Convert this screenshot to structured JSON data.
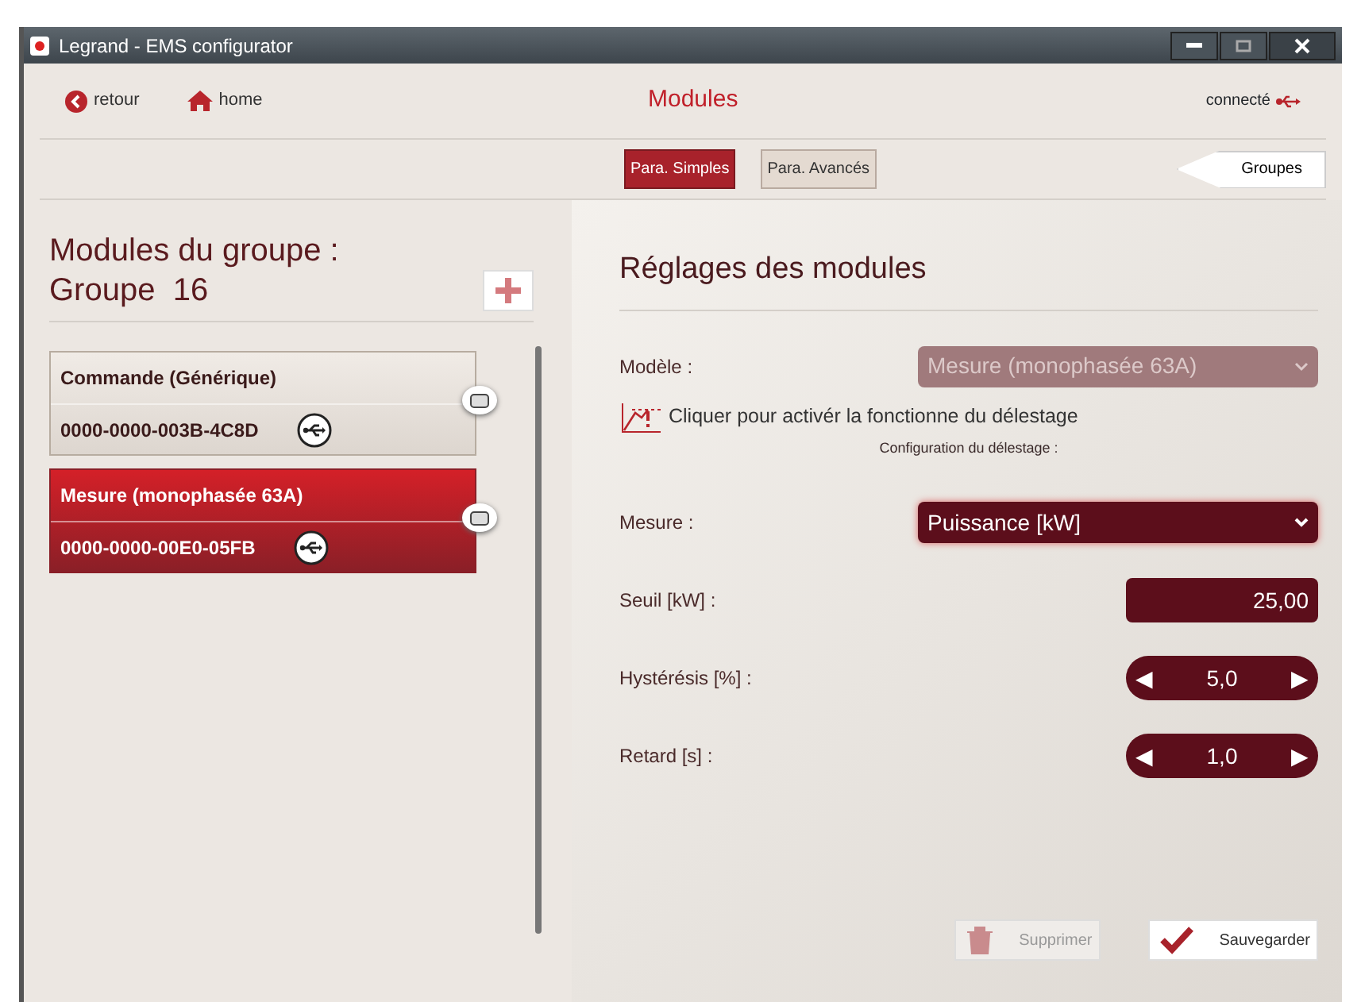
{
  "window": {
    "title": "Legrand - EMS configurator"
  },
  "header": {
    "back": "retour",
    "home": "home",
    "title": "Modules",
    "status": "connecté"
  },
  "tabs": [
    {
      "label": "Para. Simples",
      "selected": true
    },
    {
      "label": "Para. Avancés",
      "selected": false
    }
  ],
  "groups_button": "Groupes",
  "group": {
    "heading": "Modules du groupe :",
    "name": "Groupe  16"
  },
  "modules": [
    {
      "name": "Commande (Générique)",
      "id": "0000-0000-003B-4C8D",
      "selected": false
    },
    {
      "name": "Mesure (monophasée 63A)",
      "id": "0000-0000-00E0-05FB",
      "selected": true
    }
  ],
  "settings": {
    "heading": "Réglages des modules",
    "model": {
      "label": "Modèle :",
      "value": "Mesure (monophasée 63A)",
      "disabled": true
    },
    "shedding_link": "Cliquer pour activér la fonctionne du délestage",
    "config_label": "Configuration du délestage :",
    "fields": [
      {
        "kind": "select",
        "label": "Mesure :",
        "value": "Puissance [kW]"
      },
      {
        "kind": "number",
        "label": "Seuil [kW] :",
        "value": "25,00"
      },
      {
        "kind": "spinner",
        "label": "Hystérésis [%] :",
        "value": "5,0",
        "left": "◀",
        "right": "▶"
      },
      {
        "kind": "spinner",
        "label": "Retard [s] :",
        "value": "1,0",
        "left": "◀",
        "right": "▶"
      }
    ]
  },
  "buttons": [
    {
      "kind": "delete",
      "label": "Supprimer",
      "disabled": true
    },
    {
      "kind": "save",
      "label": "Sauvegarder",
      "disabled": false
    }
  ]
}
